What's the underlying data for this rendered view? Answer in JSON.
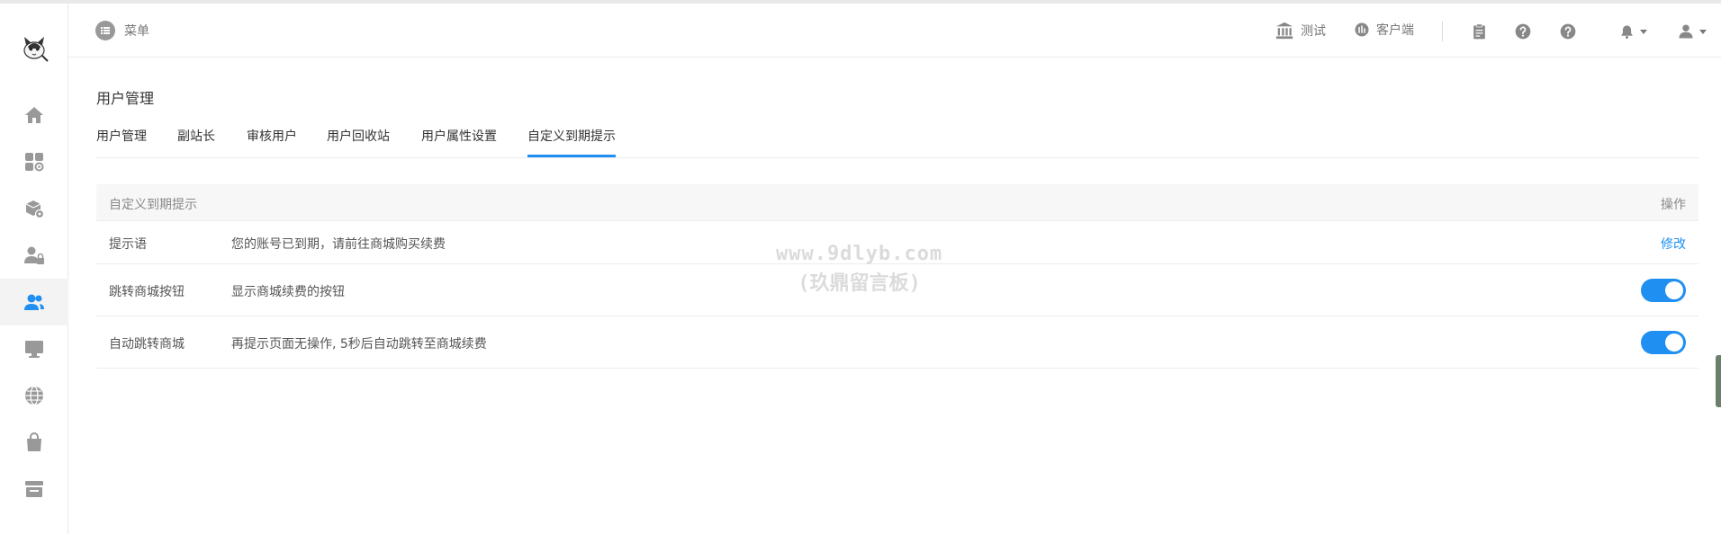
{
  "header": {
    "menu_label": "菜单",
    "links": [
      {
        "label": "测试",
        "icon": "bank-icon"
      },
      {
        "label": "客户端",
        "icon": "dashboard-icon"
      }
    ],
    "icons": [
      "clipboard-icon",
      "help-icon",
      "help-icon",
      "bell-icon",
      "user-icon"
    ]
  },
  "sidebar": {
    "items": [
      {
        "name": "home-icon"
      },
      {
        "name": "apps-icon"
      },
      {
        "name": "package-settings-icon"
      },
      {
        "name": "user-lock-icon"
      },
      {
        "name": "users-icon",
        "active": true
      },
      {
        "name": "monitor-icon"
      },
      {
        "name": "globe-icon"
      },
      {
        "name": "bag-icon"
      },
      {
        "name": "store-icon"
      }
    ]
  },
  "main": {
    "title": "用户管理",
    "tabs": [
      {
        "label": "用户管理"
      },
      {
        "label": "副站长"
      },
      {
        "label": "审核用户"
      },
      {
        "label": "用户回收站"
      },
      {
        "label": "用户属性设置"
      },
      {
        "label": "自定义到期提示",
        "active": true
      }
    ],
    "table": {
      "header_left": "自定义到期提示",
      "header_right": "操作",
      "rows": [
        {
          "label": "提示语",
          "desc": "您的账号已到期，请前往商城购买续费",
          "action": "修改"
        },
        {
          "label": "跳转商城按钮",
          "desc": "显示商城续费的按钮",
          "toggle": true
        },
        {
          "label": "自动跳转商城",
          "desc": "再提示页面无操作, 5秒后自动跳转至商城续费",
          "toggle": true
        }
      ]
    }
  },
  "watermark": {
    "line1": "www.9dlyb.com",
    "line2": "(玖鼎留言板)"
  },
  "colors": {
    "accent": "#1f8ff2",
    "icon_gray": "#999999",
    "border": "#ececec"
  }
}
